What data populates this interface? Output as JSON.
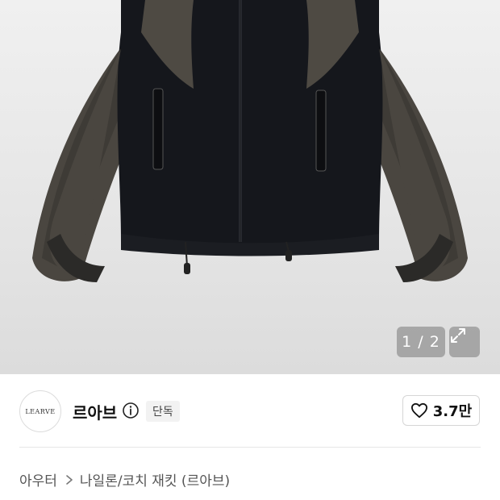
{
  "gallery": {
    "counter_text": "1 / 2",
    "current_index": 1,
    "total": 2,
    "background": "#e6e6e6",
    "expand_icon": "expand-arrows-icon"
  },
  "brand": {
    "logo_text": "LEARVE",
    "name": "르아브",
    "info_icon": "info-icon",
    "badge": "단독"
  },
  "like": {
    "icon": "heart-outline-icon",
    "count": "3.7만"
  },
  "breadcrumb": {
    "category": "아우터",
    "separator_icon": "chevron-right-icon",
    "subcategory": "나일론/코치 재킷 (르아브)"
  },
  "colors": {
    "jacket_main": "#15171c",
    "jacket_panel": "#4a4640",
    "text_primary": "#111111",
    "text_secondary": "#555555"
  }
}
